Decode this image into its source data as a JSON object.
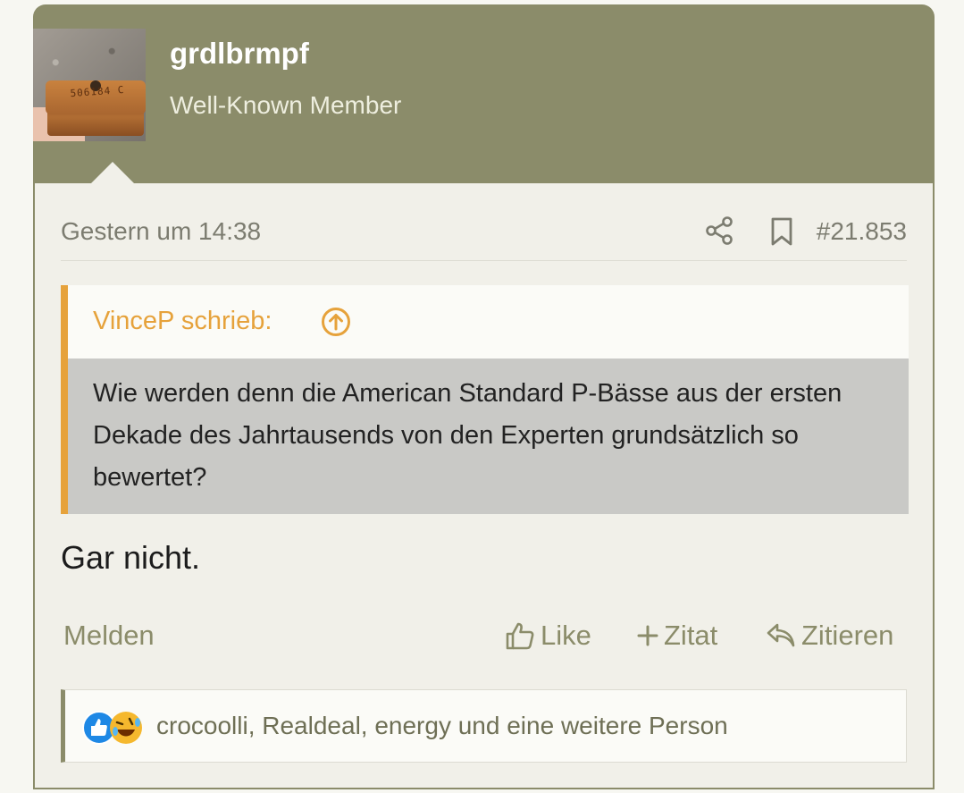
{
  "user": {
    "name": "grdlbrmpf",
    "title": "Well-Known Member",
    "avatar_plate_text": "506184 C"
  },
  "post": {
    "timestamp": "Gestern um 14:38",
    "number": "#21.853",
    "message": "Gar nicht."
  },
  "quote": {
    "author": "VinceP schrieb:",
    "text": "Wie werden denn die American Standard P-Bässe aus der ersten Dekade des Jahrtausends von den Experten grundsätzlich so bewertet?"
  },
  "actions": {
    "report": "Melden",
    "like": "Like",
    "multiquote": "Zitat",
    "reply": "Zitieren"
  },
  "reactions": {
    "icons": [
      "like-reaction-icon",
      "laugh-reaction-icon"
    ],
    "users": "crocoolli, Realdeal, energy und eine weitere Person"
  },
  "colors": {
    "header": "#8b8c6a",
    "quote_accent": "#e6a23b",
    "like_blue": "#1e88e5",
    "laugh_yellow": "#f5b82e"
  }
}
